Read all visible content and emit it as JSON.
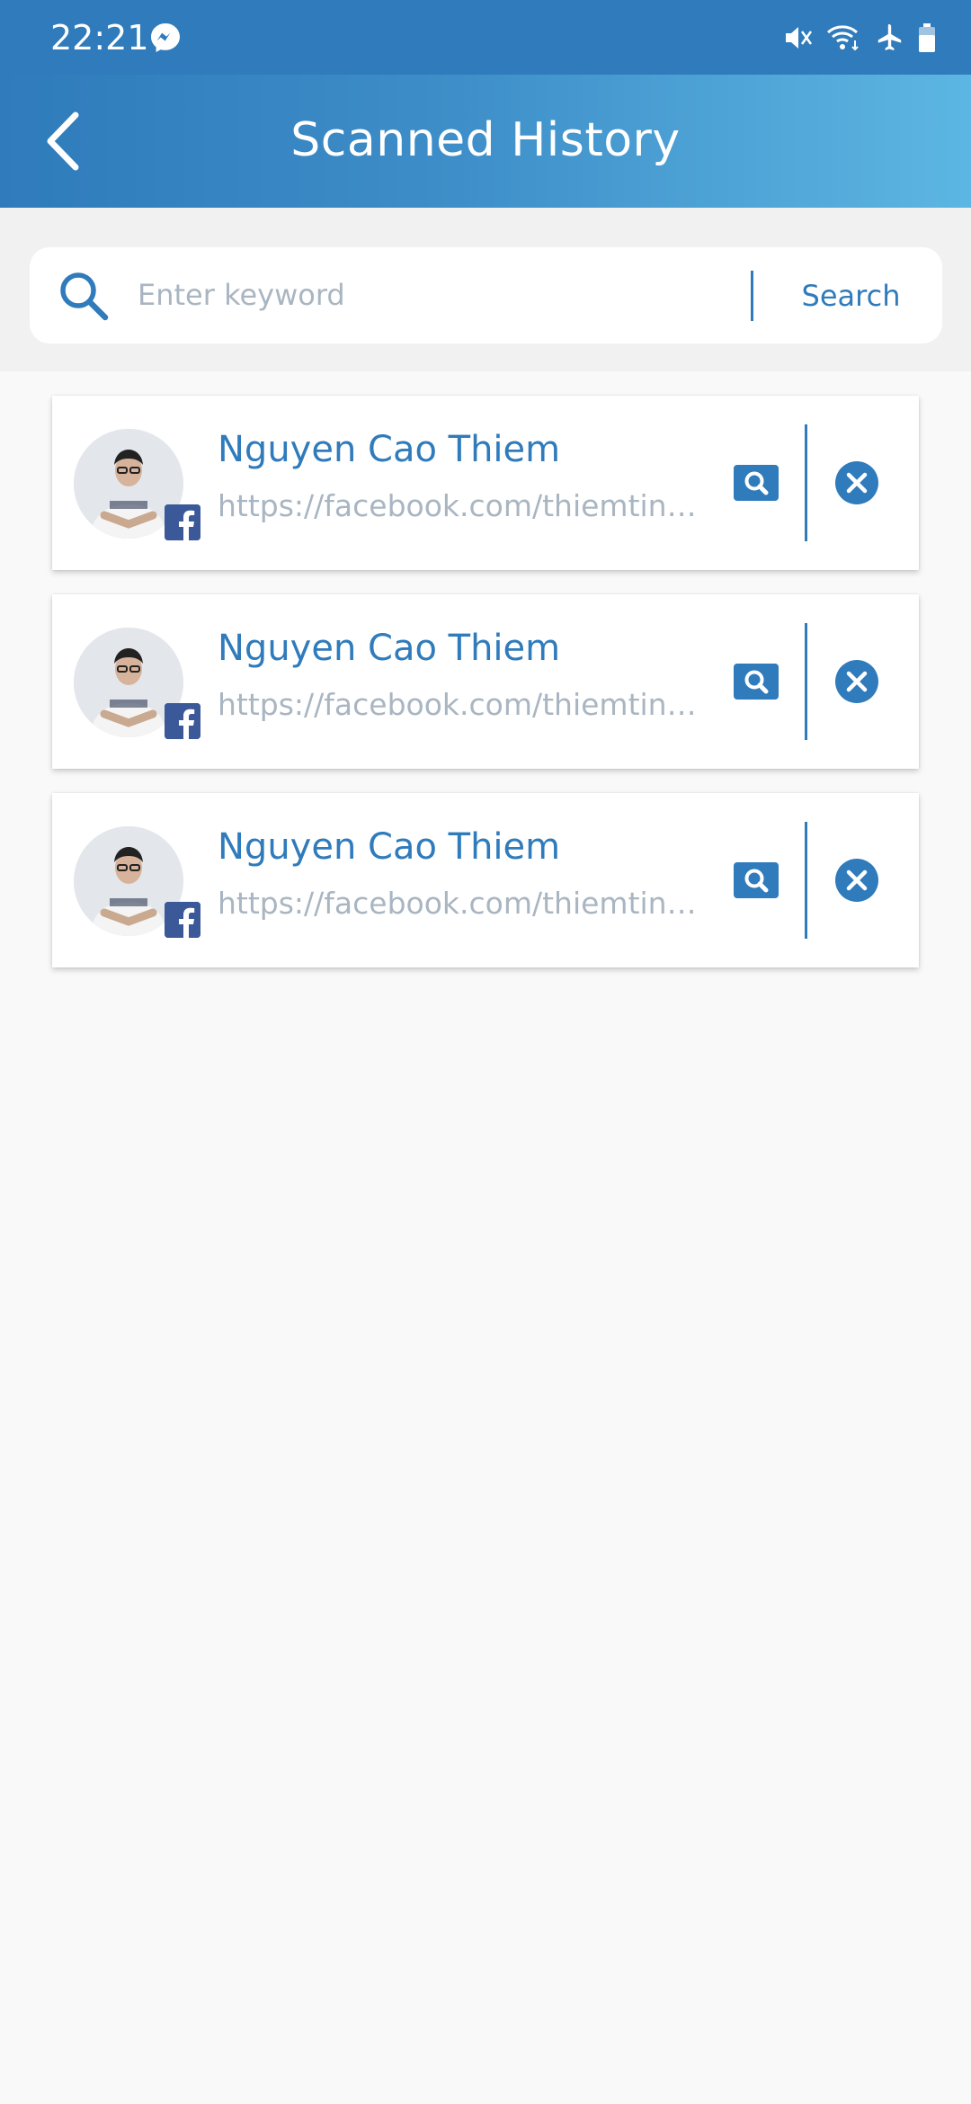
{
  "status_bar": {
    "time": "22:21",
    "left_icons": [
      "messenger-icon"
    ],
    "right_icons": [
      "vibrate-mute-icon",
      "wifi-icon",
      "airplane-mode-icon",
      "battery-icon"
    ]
  },
  "header": {
    "title": "Scanned History",
    "back_icon": "chevron-left-icon"
  },
  "search": {
    "placeholder": "Enter keyword",
    "value": "",
    "button_label": "Search",
    "icon": "search-icon"
  },
  "history": [
    {
      "name": "Nguyen Cao Thiem",
      "url": "https://facebook.com/thiemtinh...",
      "network": "facebook",
      "actions": [
        "view-icon",
        "remove-icon"
      ]
    },
    {
      "name": "Nguyen Cao Thiem",
      "url": "https://facebook.com/thiemtinh...",
      "network": "facebook",
      "actions": [
        "view-icon",
        "remove-icon"
      ]
    },
    {
      "name": "Nguyen Cao Thiem",
      "url": "https://facebook.com/thiemtinh...",
      "network": "facebook",
      "actions": [
        "view-icon",
        "remove-icon"
      ]
    }
  ],
  "colors": {
    "primary": "#2f7bbb",
    "header_gradient_end": "#5cb6e2",
    "facebook": "#3b5998",
    "muted_text": "#a9b6c2",
    "page_background": "#f9f9f9"
  }
}
